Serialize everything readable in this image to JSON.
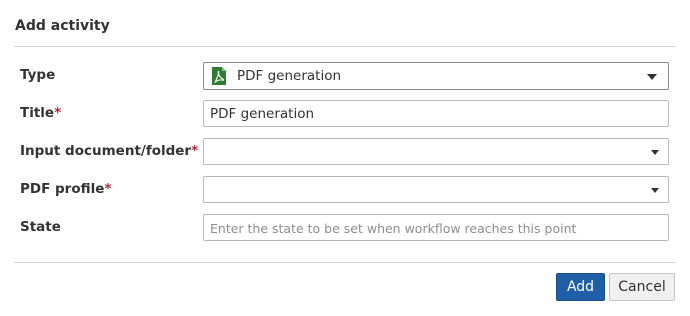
{
  "dialog": {
    "title": "Add activity"
  },
  "fields": {
    "type": {
      "label": "Type",
      "value": "PDF generation",
      "icon": "pdf-file-icon"
    },
    "title": {
      "label": "Title",
      "required_mark": "*",
      "value": "PDF generation"
    },
    "input_document": {
      "label": "Input document/folder",
      "required_mark": "*",
      "value": ""
    },
    "pdf_profile": {
      "label": "PDF profile",
      "required_mark": "*",
      "value": ""
    },
    "state": {
      "label": "State",
      "value": "",
      "placeholder": "Enter the state to be set when workflow reaches this point"
    }
  },
  "buttons": {
    "add": "Add",
    "cancel": "Cancel"
  },
  "colors": {
    "primary": "#1e5fa8",
    "required": "#b5263f",
    "pdf_icon": "#2e7d32"
  }
}
